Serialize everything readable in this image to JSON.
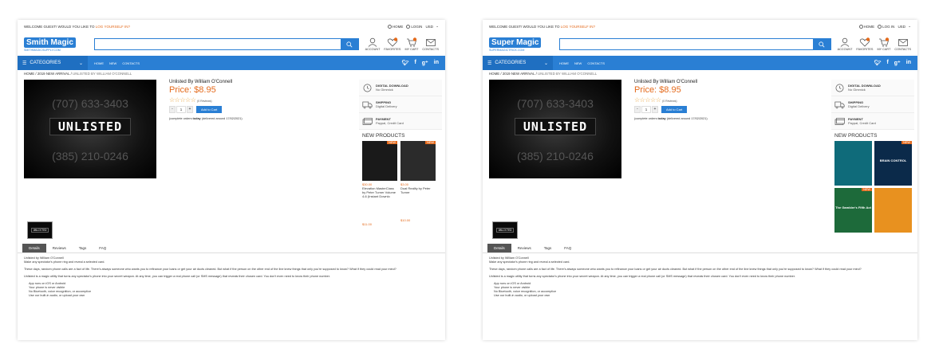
{
  "colors": {
    "brand": "#2a7fd4",
    "accent": "#e46a1c"
  },
  "left": {
    "topbar": {
      "welcome": "WELCOME GUEST! WOULD YOU LIKE TO ",
      "login_link": "LOG YOURSELF IN?",
      "home": "HOME",
      "login": "LOGIN",
      "currency": "USD"
    },
    "logo": {
      "name": "Smith Magic",
      "sub": "SMITHMAGICSUPPLY.COM"
    },
    "header_icons": [
      "ACCOUNT",
      "FAVORITES",
      "MY CART",
      "CONTACTS"
    ],
    "nav": {
      "categories": "CATEGORIES",
      "items": [
        "HOME",
        "NEW",
        "CONTACTS"
      ]
    },
    "breadcrumb": {
      "home": "HOME",
      "sep": " / ",
      "section": "2019 NEW ARRIVAL",
      "current": "UNLISTED BY WILLIAM O'CONNELL"
    },
    "product": {
      "title": "Unlisted By William O'Connell",
      "price": "Price:   $8.95",
      "stars": "☆☆☆☆☆",
      "reviews": "(0 Reviews)",
      "qty": "1",
      "add_to_cart": "Add to Cart",
      "note_pre": "(complete orders ",
      "note_bold": "today",
      "note_post": " (delivered around 17/02/2021)",
      "image": {
        "phone_top": "(707) 633-3403",
        "label": "UNLISTED",
        "phone_bottom": "(385) 210-0246"
      },
      "thumb_label": "UNLISTED"
    },
    "features": [
      {
        "title": "DIGITAL DOWNLOAD",
        "desc": "No Gimmick"
      },
      {
        "title": "SHIPPING",
        "desc": "Digital Delivery"
      },
      {
        "title": "PAYMENT",
        "desc": "Paypal, Credit Card"
      }
    ],
    "new_products_title": "NEW PRODUCTS",
    "new_products": [
      {
        "price": "$30.00",
        "badge": "NEW",
        "name": "Elevation MasterClass by Peter Turner Volume 4-6 (Instant Downlo",
        "price2": "$11.00"
      },
      {
        "price": "$3.00",
        "badge": "NEW",
        "name": "Dual Reality by Peter Turner",
        "price2": "$10.00"
      }
    ],
    "tabs": [
      "Details",
      "Reviews",
      "Tags",
      "FAQ"
    ],
    "description": {
      "intro1": "Unlisted by William O'Connell",
      "intro2": "Make any spectator's phone ring and reveal a selected card.",
      "para1": "These days, random phone calls are a fact of life. There's always someone who wants you to refinance your loans or get your air ducts cleaned. But what if the person on the other end of the line knew things that only you're supposed to know? What if they could read your mind?",
      "para2": "Unlisted is a magic utility that turns any spectator's phone into your secret weapon. At any time, you can trigger a real phone call (or SMS message) that reveals their chosen card. You don't even need to know their phone number.",
      "bullets": [
        "App runs on iOS or Android",
        "Your phone is never visible",
        "No Bluetooth, voice recognition, or accomplice",
        "Use our built-in audio, or upload your own"
      ]
    }
  },
  "right": {
    "topbar": {
      "welcome": "WELCOME GUEST! WOULD YOU LIKE TO ",
      "login_link": "LOG YOURSELF IN?",
      "home": "HOME",
      "login": "LOG IN",
      "currency": "USD"
    },
    "logo": {
      "name": "Super Magic",
      "sub": "SUPERMAGICTRICK.COM"
    },
    "header_icons": [
      "ACCOUNT",
      "FAVORITES",
      "MY CART",
      "CONTACTS"
    ],
    "nav": {
      "categories": "CATEGORIES",
      "items": [
        "HOME",
        "NEW",
        "CONTACTS"
      ]
    },
    "breadcrumb": {
      "home": "HOME",
      "sep": " / ",
      "section": "2019 NEW ARRIVAL",
      "current": "UNLISTED BY WILLIAM O'CONNELL"
    },
    "product": {
      "title": "Unlisted By William O'Connell",
      "price": "Price:   $8.95",
      "stars": "☆☆☆☆☆",
      "reviews": "(0 Reviews)",
      "qty": "1",
      "add_to_cart": "Add to Cart",
      "note_pre": "(complete orders ",
      "note_bold": "today",
      "note_post": " (delivered around 17/02/2021)",
      "image": {
        "phone_top": "(707) 633-3403",
        "label": "UNLISTED",
        "phone_bottom": "(385) 210-0246"
      },
      "thumb_label": "UNLISTED"
    },
    "features": [
      {
        "title": "DIGITAL DOWNLOAD",
        "desc": "No Gimmick"
      },
      {
        "title": "SHIPPING",
        "desc": "Digital Delivery"
      },
      {
        "title": "PAYMENT",
        "desc": "Paypal, Credit Card"
      }
    ],
    "new_products_title": "NEW PRODUCTS",
    "new_products_tiles": [
      {
        "label": "",
        "badge": ""
      },
      {
        "label": "BRAIN CONTROL",
        "badge": "NEW"
      },
      {
        "label": "The Gambler's Fifth Act",
        "badge": "NEW"
      },
      {
        "label": "",
        "badge": ""
      }
    ],
    "tabs": [
      "Details",
      "Reviews",
      "Tags",
      "FAQ"
    ],
    "description": {
      "intro1": "Unlisted by William O'Connell",
      "intro2": "Make any spectator's phone ring and reveal a selected card.",
      "para1": "These days, random phone calls are a fact of life. There's always someone who wants you to refinance your loans or get your air ducts cleaned. But what if the person on the other end of the line knew things that only you're supposed to know? What if they could read your mind?",
      "para2": "Unlisted is a magic utility that turns any spectator's phone into your secret weapon. At any time, you can trigger a real phone call (or SMS message) that reveals their chosen card. You don't even need to know their phone number.",
      "bullets": [
        "App runs on iOS or Android",
        "Your phone is never visible",
        "No Bluetooth, voice recognition, or accomplice",
        "Use our built-in audio, or upload your own"
      ]
    }
  }
}
